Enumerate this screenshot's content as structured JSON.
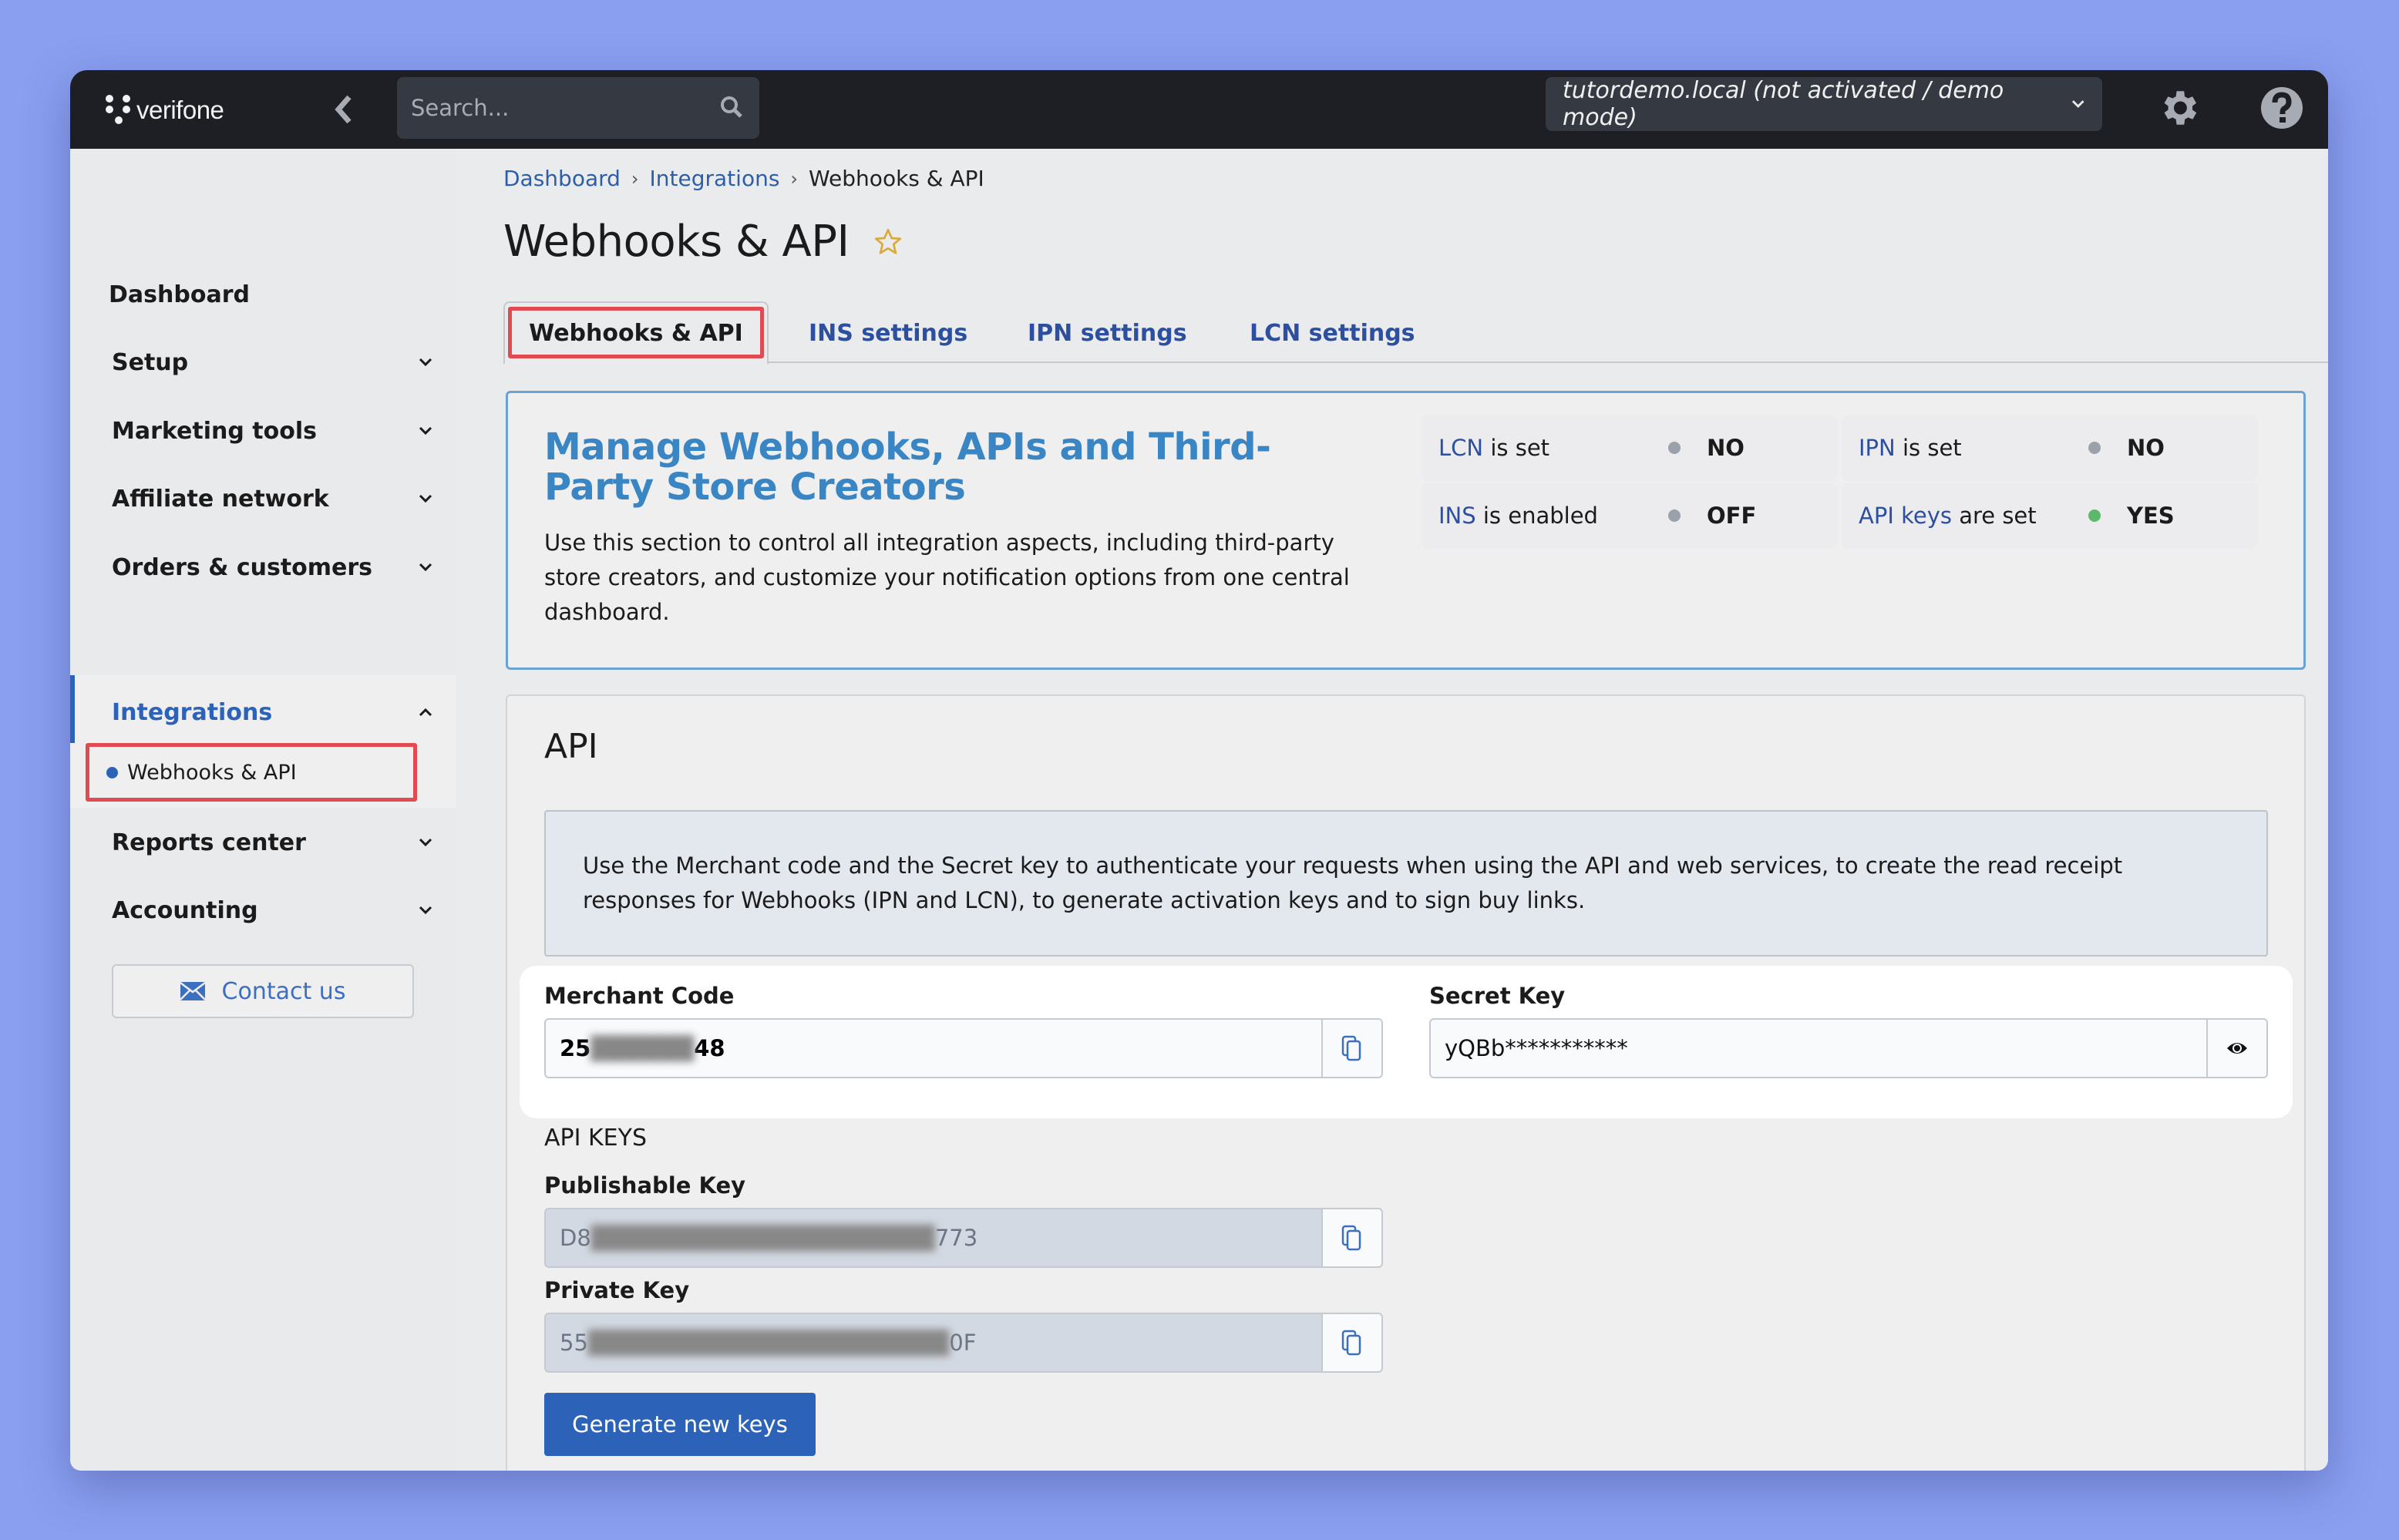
{
  "header": {
    "brand": "verifone",
    "search_placeholder": "Search...",
    "account_selector": "tutordemo.local (not activated / demo mode)"
  },
  "sidebar": {
    "items": [
      {
        "label": "Dashboard",
        "expandable": false
      },
      {
        "label": "Setup",
        "expandable": true
      },
      {
        "label": "Marketing tools",
        "expandable": true
      },
      {
        "label": "Affiliate network",
        "expandable": true
      },
      {
        "label": "Orders & customers",
        "expandable": true
      },
      {
        "label": "Integrations",
        "expandable": true,
        "expanded": true,
        "active": true
      },
      {
        "label": "Reports center",
        "expandable": true
      },
      {
        "label": "Accounting",
        "expandable": true
      }
    ],
    "sub_item": "Webhooks & API",
    "contact_label": "Contact us"
  },
  "breadcrumb": [
    "Dashboard",
    "Integrations",
    "Webhooks & API"
  ],
  "page_title": "Webhooks & API",
  "tabs": [
    {
      "label": "Webhooks & API",
      "active": true
    },
    {
      "label": "INS settings"
    },
    {
      "label": "IPN settings"
    },
    {
      "label": "LCN settings"
    }
  ],
  "overview": {
    "title": "Manage Webhooks, APIs and Third-Party Store Creators",
    "description": "Use this section to control all integration aspects, including third-party store creators, and customize your notification options from one central dashboard.",
    "statuses": [
      {
        "link": "LCN",
        "text": " is set",
        "value": "NO",
        "color": "#9ba1ab"
      },
      {
        "link": "IPN",
        "text": " is set",
        "value": "NO",
        "color": "#9ba1ab"
      },
      {
        "link": "INS",
        "text": " is enabled",
        "value": "OFF",
        "color": "#9ba1ab"
      },
      {
        "link": "API keys",
        "text": " are set",
        "value": "YES",
        "color": "#5cb86a"
      }
    ]
  },
  "api": {
    "heading": "API",
    "info": "Use the Merchant code and the Secret key to authenticate your requests when using the API and web services, to create the read receipt responses for Webhooks (IPN and LCN), to generate activation keys and to sign buy links.",
    "merchant_code_label": "Merchant Code",
    "merchant_code_prefix": "25",
    "merchant_code_suffix": "48",
    "secret_key_label": "Secret Key",
    "secret_key_value": "yQBb***********",
    "api_keys_label": "API KEYS",
    "publishable_key_label": "Publishable Key",
    "publishable_key_prefix": "D8",
    "publishable_key_suffix": "773",
    "private_key_label": "Private Key",
    "private_key_prefix": "55",
    "private_key_suffix": "0F",
    "generate_button": "Generate new keys"
  },
  "colors": {
    "accent": "#2c63b8",
    "highlight": "#e04a50",
    "header_bg": "#1d1f24",
    "title_blue": "#3a86c4"
  }
}
